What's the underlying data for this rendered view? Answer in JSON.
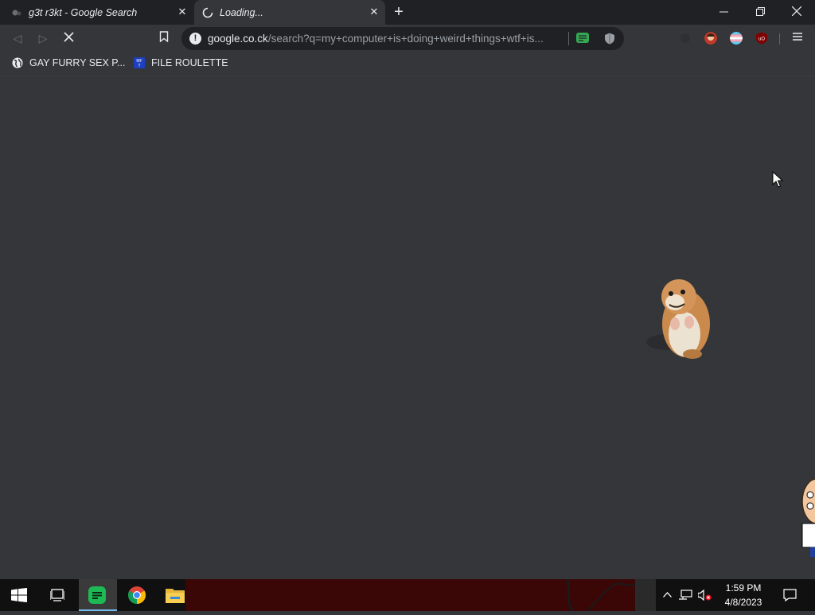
{
  "tabs": [
    {
      "title": "g3t r3kt - Google Search",
      "active": false
    },
    {
      "title": "Loading...",
      "active": true
    }
  ],
  "address_bar": {
    "host": "google.co.ck",
    "path": "/search?q=my+computer+is+doing+weird+things+wtf+is..."
  },
  "bookmarks": [
    {
      "label": "GAY FURRY SEX P...",
      "icon": "globe-icon"
    },
    {
      "label": "FILE ROULETTE",
      "icon": "mft-icon"
    }
  ],
  "taskbar": {
    "apps": [
      "windows-start-icon",
      "task-view-icon",
      "spotify-icon",
      "chrome-icon",
      "file-explorer-icon"
    ],
    "time": "1:59 PM",
    "date": "4/8/2023"
  },
  "colors": {
    "titlebar": "#202124",
    "toolbar": "#35363a",
    "taskbar": "#101010",
    "spotify": "#1db954"
  }
}
